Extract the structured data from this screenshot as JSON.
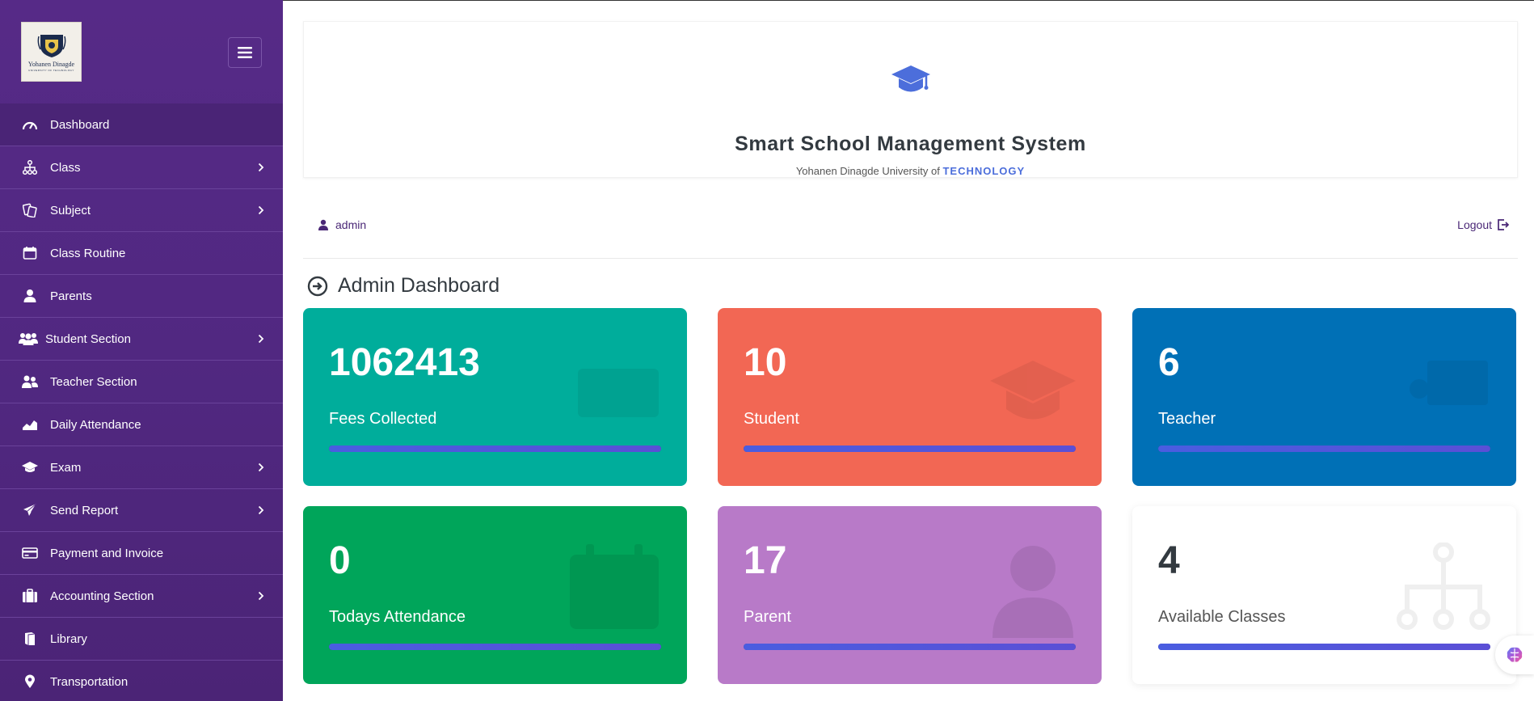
{
  "logo": {
    "label": "Yohanen Dinagde",
    "sub": "UNIVERSITY OF TECHNOLOGY"
  },
  "sidebar": {
    "items": [
      {
        "label": "Dashboard",
        "icon": "dashboard-gauge-icon",
        "active": true,
        "has_chevron": false
      },
      {
        "label": "Class",
        "icon": "sitemap-icon",
        "has_chevron": true
      },
      {
        "label": "Subject",
        "icon": "books-icon",
        "has_chevron": true
      },
      {
        "label": "Class Routine",
        "icon": "calendar-icon",
        "has_chevron": false
      },
      {
        "label": "Parents",
        "icon": "user-icon",
        "has_chevron": false
      },
      {
        "label": "Student Section",
        "icon": "users-icon",
        "has_chevron": true
      },
      {
        "label": "Teacher Section",
        "icon": "user-friends-icon",
        "has_chevron": false
      },
      {
        "label": "Daily Attendance",
        "icon": "area-chart-icon",
        "has_chevron": false
      },
      {
        "label": "Exam",
        "icon": "graduation-cap-icon",
        "has_chevron": true
      },
      {
        "label": "Send Report",
        "icon": "paper-plane-icon",
        "has_chevron": true
      },
      {
        "label": "Payment and Invoice",
        "icon": "credit-card-icon",
        "has_chevron": false
      },
      {
        "label": "Accounting Section",
        "icon": "briefcase-icon",
        "has_chevron": true
      },
      {
        "label": "Library",
        "icon": "book-icon",
        "has_chevron": false
      },
      {
        "label": "Transportation",
        "icon": "map-marker-icon",
        "has_chevron": false
      }
    ]
  },
  "header": {
    "title": "Smart School Management System",
    "subtitle_prefix": "Yohanen Dinagde University of ",
    "subtitle_highlight": "TECHNOLOGY"
  },
  "userbar": {
    "username": "admin",
    "logout_label": "Logout"
  },
  "dashboard": {
    "title": "Admin Dashboard",
    "cards": [
      {
        "value": "1062413",
        "label": "Fees Collected",
        "color": "#00ad9b",
        "progress": 1.0
      },
      {
        "value": "10",
        "label": "Student",
        "color": "#f26754",
        "progress": 1.0
      },
      {
        "value": "6",
        "label": "Teacher",
        "color": "#0070b6",
        "progress": 1.0
      },
      {
        "value": "0",
        "label": "Todays Attendance",
        "color": "#00a55a",
        "progress": 1.0
      },
      {
        "value": "17",
        "label": "Parent",
        "color": "#b87ac8",
        "progress": 1.0
      },
      {
        "value": "4",
        "label": "Available Classes",
        "color": "#ffffff",
        "progress": 1.0
      }
    ]
  },
  "colors": {
    "sidebar": "#562a87",
    "accent": "#4c6edb",
    "link": "#4a2776"
  }
}
